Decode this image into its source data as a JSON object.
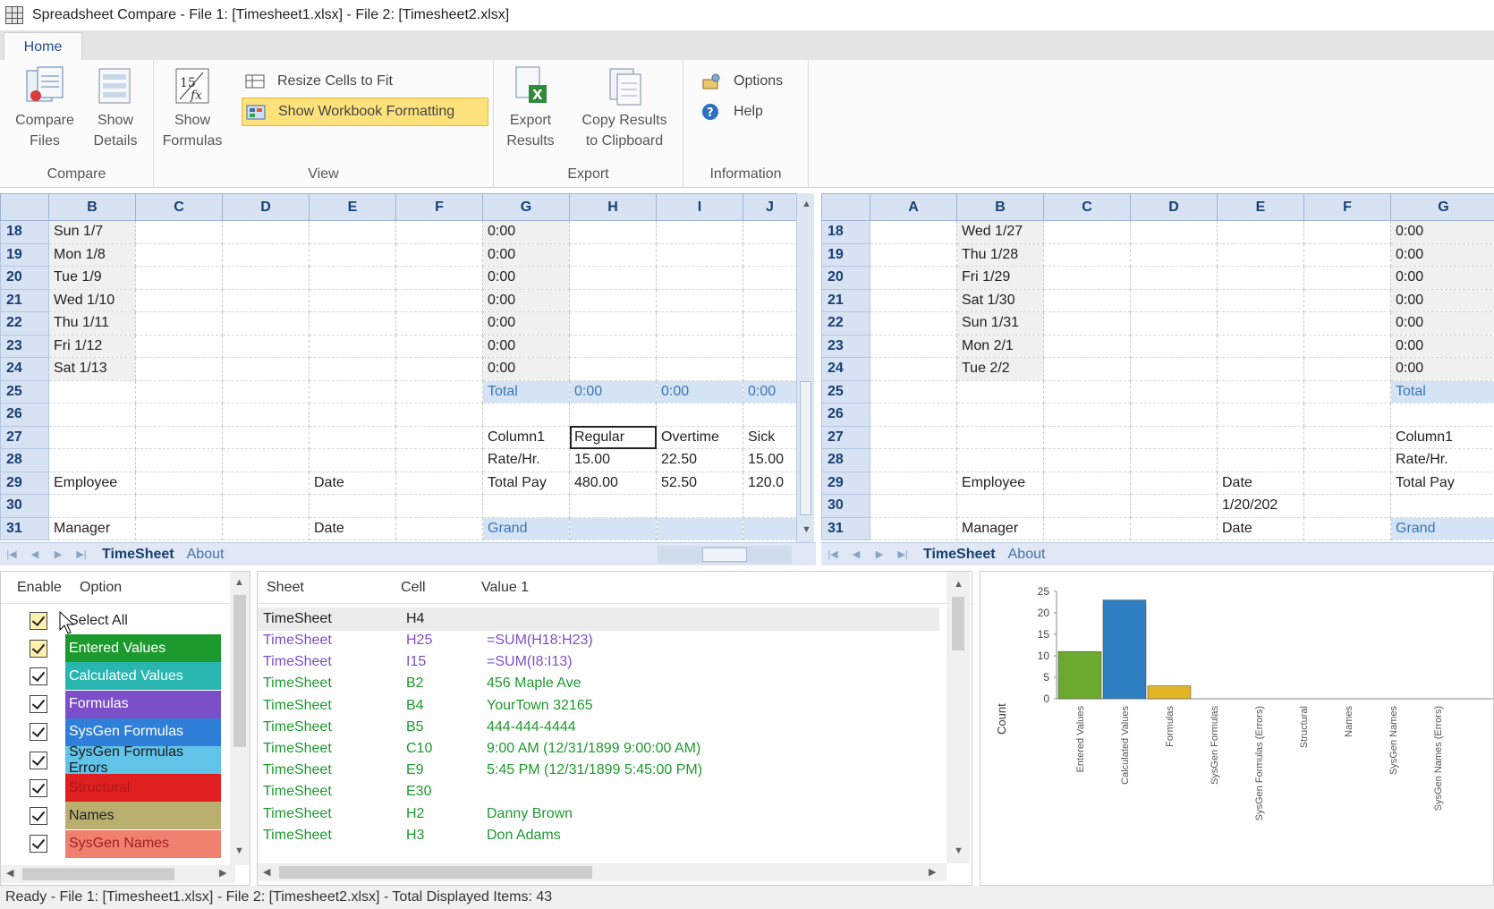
{
  "window": {
    "title": "Spreadsheet Compare - File 1: [Timesheet1.xlsx] - File 2: [Timesheet2.xlsx]"
  },
  "ribbon": {
    "tab": "Home",
    "compare": {
      "group": "Compare",
      "compare_files_1": "Compare",
      "compare_files_2": "Files",
      "show_details_1": "Show",
      "show_details_2": "Details"
    },
    "view": {
      "group": "View",
      "show_formulas_1": "Show",
      "show_formulas_2": "Formulas",
      "resize": "Resize Cells to Fit",
      "show_formatting": "Show Workbook Formatting"
    },
    "export": {
      "group": "Export",
      "export_results_1": "Export",
      "export_results_2": "Results",
      "copy_results_1": "Copy Results",
      "copy_results_2": "to Clipboard"
    },
    "information": {
      "group": "Information",
      "options": "Options",
      "help": "Help"
    }
  },
  "left_grid": {
    "columns": [
      "B",
      "C",
      "D",
      "E",
      "F",
      "G",
      "H",
      "I",
      "J"
    ],
    "rows": [
      {
        "n": "18",
        "B": "Sun 1/7",
        "G": "0:00"
      },
      {
        "n": "19",
        "B": "Mon 1/8",
        "G": "0:00"
      },
      {
        "n": "20",
        "B": "Tue 1/9",
        "G": "0:00"
      },
      {
        "n": "21",
        "B": "Wed 1/10",
        "G": "0:00"
      },
      {
        "n": "22",
        "B": "Thu 1/11",
        "G": "0:00"
      },
      {
        "n": "23",
        "B": "Fri 1/12",
        "G": "0:00"
      },
      {
        "n": "24",
        "B": "Sat 1/13",
        "G": "0:00"
      },
      {
        "n": "25",
        "G": "Total",
        "H": "0:00",
        "I": "0:00",
        "J": "0:00"
      },
      {
        "n": "26"
      },
      {
        "n": "27",
        "G": "Column1",
        "H": "Regular",
        "I": "Overtime",
        "J": "Sick"
      },
      {
        "n": "28",
        "G": "Rate/Hr.",
        "H": "15.00",
        "I": "22.50",
        "J": "15.00"
      },
      {
        "n": "29",
        "B": "Employee",
        "E": "Date",
        "G": "Total Pay",
        "H": "480.00",
        "I": "52.50",
        "J": "120.0"
      },
      {
        "n": "30"
      },
      {
        "n": "31",
        "B": "Manager",
        "E": "Date",
        "G": "Grand"
      }
    ],
    "tabs": [
      "TimeSheet",
      "About"
    ]
  },
  "right_grid": {
    "columns": [
      "A",
      "B",
      "C",
      "D",
      "E",
      "F",
      "G"
    ],
    "rows": [
      {
        "n": "18",
        "B": "Wed 1/27",
        "G": "0:00"
      },
      {
        "n": "19",
        "B": "Thu 1/28",
        "G": "0:00"
      },
      {
        "n": "20",
        "B": "Fri 1/29",
        "G": "0:00"
      },
      {
        "n": "21",
        "B": "Sat 1/30",
        "G": "0:00"
      },
      {
        "n": "22",
        "B": "Sun 1/31",
        "G": "0:00"
      },
      {
        "n": "23",
        "B": "Mon 2/1",
        "G": "0:00"
      },
      {
        "n": "24",
        "B": "Tue 2/2",
        "G": "0:00"
      },
      {
        "n": "25",
        "G": "Total"
      },
      {
        "n": "26"
      },
      {
        "n": "27",
        "G": "Column1"
      },
      {
        "n": "28",
        "G": "Rate/Hr."
      },
      {
        "n": "29",
        "B": "Employee",
        "E": "Date",
        "G": "Total Pay"
      },
      {
        "n": "30",
        "E": "1/20/202"
      },
      {
        "n": "31",
        "B": "Manager",
        "E": "Date",
        "G": "Grand"
      }
    ],
    "tabs": [
      "TimeSheet",
      "About"
    ]
  },
  "options": {
    "headers": {
      "enable": "Enable",
      "option": "Option"
    },
    "items": [
      {
        "label": "Select All",
        "color": "#ffffff",
        "text": "#222222"
      },
      {
        "label": "Entered Values",
        "color": "#1d9a2e",
        "text": "#ffffff"
      },
      {
        "label": "Calculated Values",
        "color": "#29b6b0",
        "text": "#ffffff"
      },
      {
        "label": "Formulas",
        "color": "#7b4fc8",
        "text": "#ffffff"
      },
      {
        "label": "SysGen Formulas",
        "color": "#2f7fd8",
        "text": "#ffffff"
      },
      {
        "label": "SysGen Formulas Errors",
        "color": "#62c3e8",
        "text": "#1a1a1a"
      },
      {
        "label": "Structural",
        "color": "#e02020",
        "text": "#b01818"
      },
      {
        "label": "Names",
        "color": "#b9b070",
        "text": "#222222"
      },
      {
        "label": "SysGen Names",
        "color": "#f08070",
        "text": "#a02020"
      }
    ]
  },
  "results": {
    "headers": {
      "sheet": "Sheet",
      "cell": "Cell",
      "value": "Value 1"
    },
    "rows": [
      {
        "sheet": "TimeSheet",
        "cell": "H4",
        "value": "",
        "color": "#222222"
      },
      {
        "sheet": "TimeSheet",
        "cell": "H25",
        "value": "=SUM(H18:H23)",
        "color": "#7b4fc8"
      },
      {
        "sheet": "TimeSheet",
        "cell": "I15",
        "value": "=SUM(I8:I13)",
        "color": "#7b4fc8"
      },
      {
        "sheet": "TimeSheet",
        "cell": "B2",
        "value": "456 Maple Ave",
        "color": "#1d9a2e"
      },
      {
        "sheet": "TimeSheet",
        "cell": "B4",
        "value": "YourTown 32165",
        "color": "#1d9a2e"
      },
      {
        "sheet": "TimeSheet",
        "cell": "B5",
        "value": "444-444-4444",
        "color": "#1d9a2e"
      },
      {
        "sheet": "TimeSheet",
        "cell": "C10",
        "value": "9:00 AM (12/31/1899 9:00:00 AM)",
        "color": "#1d9a2e"
      },
      {
        "sheet": "TimeSheet",
        "cell": "E9",
        "value": "5:45 PM (12/31/1899 5:45:00 PM)",
        "color": "#1d9a2e"
      },
      {
        "sheet": "TimeSheet",
        "cell": "E30",
        "value": "",
        "color": "#1d9a2e"
      },
      {
        "sheet": "TimeSheet",
        "cell": "H2",
        "value": "Danny Brown",
        "color": "#1d9a2e"
      },
      {
        "sheet": "TimeSheet",
        "cell": "H3",
        "value": "Don Adams",
        "color": "#1d9a2e"
      }
    ]
  },
  "chart_data": {
    "type": "bar",
    "ylabel": "Count",
    "ylim": [
      0,
      25
    ],
    "yticks": [
      "25",
      "20",
      "15",
      "10",
      "5",
      "0"
    ],
    "categories": [
      "Entered Values",
      "Calculated Values",
      "Formulas",
      "SysGen Formulas",
      "SysGen Formulas (Errors)",
      "Structural",
      "Names",
      "SysGen Names",
      "SysGen Names (Errors)"
    ],
    "values": [
      11,
      23,
      3,
      0,
      0,
      0,
      0,
      0,
      0
    ],
    "colors": [
      "#6aaa2f",
      "#2e7fc1",
      "#e2b528",
      "#999999",
      "#999999",
      "#999999",
      "#999999",
      "#999999",
      "#999999"
    ]
  },
  "status": {
    "text": "Ready - File 1: [Timesheet1.xlsx] - File 2: [Timesheet2.xlsx] - Total Displayed Items: 43"
  }
}
